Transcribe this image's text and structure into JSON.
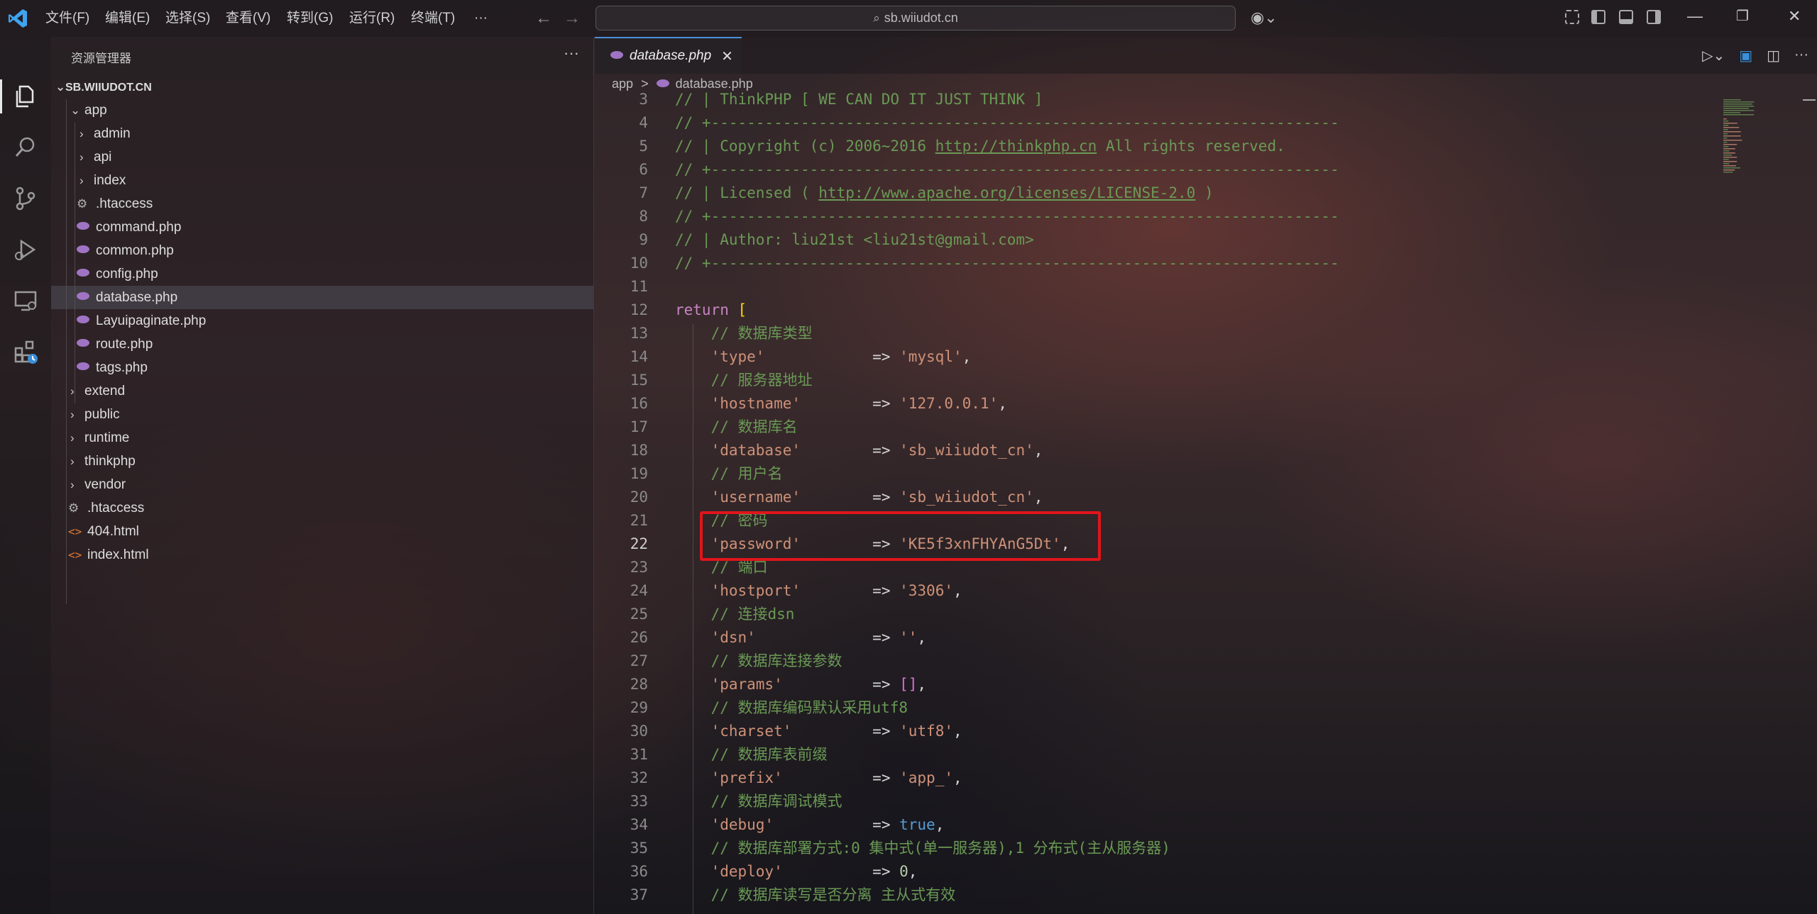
{
  "menu": [
    "文件(F)",
    "编辑(E)",
    "选择(S)",
    "查看(V)",
    "转到(G)",
    "运行(R)",
    "终端(T)",
    "···"
  ],
  "search": {
    "text": "sb.wiiudot.cn"
  },
  "sidebar": {
    "title": "资源管理器",
    "more": "···",
    "root": "SB.WIIUDOT.CN",
    "items": [
      {
        "label": "app",
        "kind": "folder-open"
      },
      {
        "label": "admin",
        "kind": "folder"
      },
      {
        "label": "api",
        "kind": "folder"
      },
      {
        "label": "index",
        "kind": "folder"
      },
      {
        "label": ".htaccess",
        "kind": "gear"
      },
      {
        "label": "command.php",
        "kind": "php"
      },
      {
        "label": "common.php",
        "kind": "php"
      },
      {
        "label": "config.php",
        "kind": "php"
      },
      {
        "label": "database.php",
        "kind": "php",
        "selected": true
      },
      {
        "label": "Layuipaginate.php",
        "kind": "php"
      },
      {
        "label": "route.php",
        "kind": "php"
      },
      {
        "label": "tags.php",
        "kind": "php"
      },
      {
        "label": "extend",
        "kind": "folder"
      },
      {
        "label": "public",
        "kind": "folder"
      },
      {
        "label": "runtime",
        "kind": "folder"
      },
      {
        "label": "thinkphp",
        "kind": "folder"
      },
      {
        "label": "vendor",
        "kind": "folder"
      },
      {
        "label": ".htaccess",
        "kind": "gear"
      },
      {
        "label": "404.html",
        "kind": "html"
      },
      {
        "label": "index.html",
        "kind": "html"
      }
    ]
  },
  "editor": {
    "tab_label": "database.php",
    "tab_close": "✕",
    "breadcrumb": [
      "app",
      ">",
      "database.php"
    ],
    "lines": [
      {
        "n": "3",
        "code": "// | ThinkPHP [ WE CAN DO IT JUST THINK ]"
      },
      {
        "n": "4",
        "code": "// +----------------------------------------------------------------------"
      },
      {
        "n": "5",
        "code": "// | Copyright (c) 2006~2016 http://thinkphp.cn All rights reserved."
      },
      {
        "n": "6",
        "code": "// +----------------------------------------------------------------------"
      },
      {
        "n": "7",
        "code": "// | Licensed ( http://www.apache.org/licenses/LICENSE-2.0 )"
      },
      {
        "n": "8",
        "code": "// +----------------------------------------------------------------------"
      },
      {
        "n": "9",
        "code": "// | Author: liu21st <liu21st@gmail.com>"
      },
      {
        "n": "10",
        "code": "// +----------------------------------------------------------------------"
      },
      {
        "n": "11",
        "code": ""
      },
      {
        "n": "12",
        "code": "return ["
      },
      {
        "n": "13",
        "code": "    // 数据库类型"
      },
      {
        "n": "14",
        "code": "    'type'            => 'mysql',"
      },
      {
        "n": "15",
        "code": "    // 服务器地址"
      },
      {
        "n": "16",
        "code": "    'hostname'        => '127.0.0.1',"
      },
      {
        "n": "17",
        "code": "    // 数据库名"
      },
      {
        "n": "18",
        "code": "    'database'        => 'sb_wiiudot_cn',"
      },
      {
        "n": "19",
        "code": "    // 用户名"
      },
      {
        "n": "20",
        "code": "    'username'        => 'sb_wiiudot_cn',"
      },
      {
        "n": "21",
        "code": "    // 密码"
      },
      {
        "n": "22",
        "code": "    'password'        => 'KE5f3xnFHYAnG5Dt',"
      },
      {
        "n": "23",
        "code": "    // 端口"
      },
      {
        "n": "24",
        "code": "    'hostport'        => '3306',"
      },
      {
        "n": "25",
        "code": "    // 连接dsn"
      },
      {
        "n": "26",
        "code": "    'dsn'             => '',"
      },
      {
        "n": "27",
        "code": "    // 数据库连接参数"
      },
      {
        "n": "28",
        "code": "    'params'          => [],"
      },
      {
        "n": "29",
        "code": "    // 数据库编码默认采用utf8"
      },
      {
        "n": "30",
        "code": "    'charset'         => 'utf8',"
      },
      {
        "n": "31",
        "code": "    // 数据库表前缀"
      },
      {
        "n": "32",
        "code": "    'prefix'          => 'app_',"
      },
      {
        "n": "33",
        "code": "    // 数据库调试模式"
      },
      {
        "n": "34",
        "code": "    'debug'           => true,"
      },
      {
        "n": "35",
        "code": "    // 数据库部署方式:0 集中式(单一服务器),1 分布式(主从服务器)"
      },
      {
        "n": "36",
        "code": "    'deploy'          => 0,"
      },
      {
        "n": "37",
        "code": "    // 数据库读写是否分离 主从式有效"
      }
    ]
  },
  "colors": {
    "highlight_box": "#e0151b",
    "accent": "#4a8fd8"
  }
}
